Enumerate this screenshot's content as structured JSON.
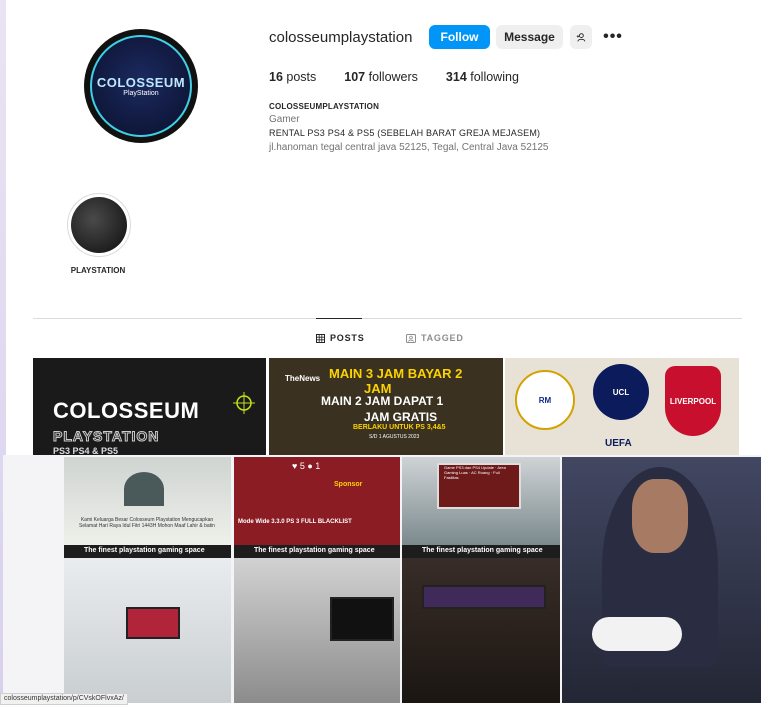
{
  "profile": {
    "username": "colosseumplaystation",
    "avatar_title": "COLOSSEUM",
    "avatar_sub": "PlayStation",
    "follow_label": "Follow",
    "message_label": "Message",
    "add_user_icon": "person-add-icon",
    "more_icon": "more-horizontal-icon",
    "more_label": "•••"
  },
  "stats": {
    "posts_count": "16",
    "posts_label": " posts",
    "followers_count": "107",
    "followers_label": " followers",
    "following_count": "314",
    "following_label": " following"
  },
  "bio": {
    "name": "COLOSSEUMPLAYSTATION",
    "category": "Gamer",
    "line1": "RENTAL PS3 PS4 & PS5 (SEBELAH BARAT GREJA MEJASEM)",
    "address": "jl.hanoman tegal central java 52125, Tegal, Central Java 52125"
  },
  "highlights": [
    {
      "label": "PLAYSTATION"
    }
  ],
  "tabs": {
    "posts": "POSTS",
    "tagged": "TAGGED"
  },
  "posts": {
    "tile1_title": "COLOSSEUM",
    "tile1_sub": "PLAYSTATION",
    "tile1_sub2": "PS3 PS4 & PS5",
    "tile2_news": "TheNews",
    "tile2_l1": "MAIN 3 JAM BAYAR 2",
    "tile2_l2": "JAM",
    "tile2_l3": "MAIN 2 JAM DAPAT 1",
    "tile2_l4": "JAM GRATIS",
    "tile2_l5": "BERLAKU UNTUK PS 3,4&5",
    "tile2_l6": "S/D 1 AGUSTUS 2023",
    "tile3_label": "UEFA",
    "crest_rm": "RM",
    "crest_ucl": "UCL",
    "crest_lfc": "LIVERPOOL"
  },
  "collage": {
    "mosque_text": "Kami Keluarga Besar Colosseum Playstation Mengucapkan Selamat Hari Raya Idul Fitri 1443H Mohon Maaf Lahir & batin",
    "flyer_badge": "♥ 5   ● 1",
    "flyer_l1": "Sponsor",
    "flyer_l2": "Mode Wide 3.3.0  PS 3  FULL BLACKLIST",
    "street_text": "Game PS3 dan PS4 Update · Area Gaming Luas · AC Ruang · Full Fasilitas",
    "photo_caption": "The finest playstation gaming space"
  },
  "statusbar": {
    "url": "colosseumplaystation/p/CVskOFlvxAz/"
  },
  "colors": {
    "accent": "#0095f6",
    "promo_yellow": "#fbd300"
  }
}
